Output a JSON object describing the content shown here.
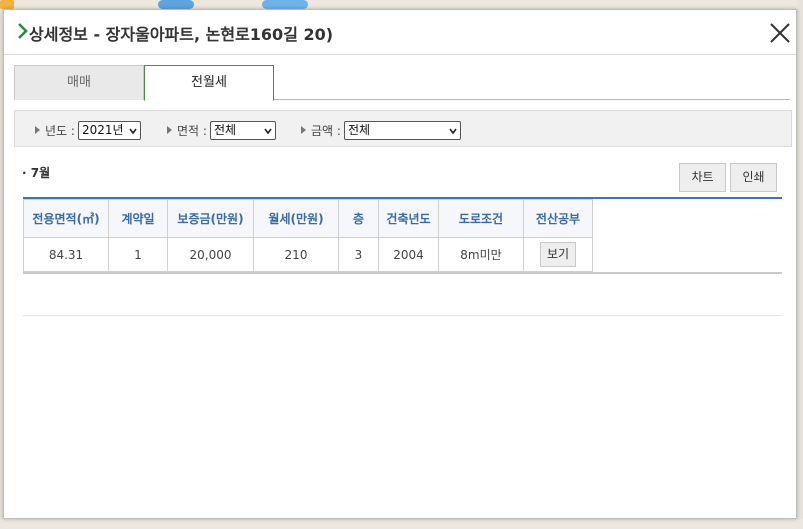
{
  "dialog": {
    "title": "상세정보 - 장자울아파트, 논현로160길 20)"
  },
  "tabs": [
    {
      "label": "매매",
      "active": false
    },
    {
      "label": "전월세",
      "active": true
    }
  ],
  "filters": {
    "year": {
      "label": "년도 :",
      "value": "2021년"
    },
    "area": {
      "label": "면적 :",
      "value": "전체"
    },
    "amount": {
      "label": "금액 :",
      "value": "전체"
    }
  },
  "month_label": "· 7월",
  "buttons": {
    "chart": "차트",
    "print": "인쇄",
    "view": "보기"
  },
  "table": {
    "headers": [
      "전용면적(㎡)",
      "계약일",
      "보증금(만원)",
      "월세(만원)",
      "층",
      "건축년도",
      "도로조건",
      "전산공부"
    ],
    "rows": [
      [
        "84.31",
        "1",
        "20,000",
        "210",
        "3",
        "2004",
        "8m미만",
        "보기"
      ]
    ]
  },
  "colors": {
    "accent_green": "#4f8a48",
    "header_blue": "#3a6aa5",
    "table_topline": "#3a76b5"
  }
}
